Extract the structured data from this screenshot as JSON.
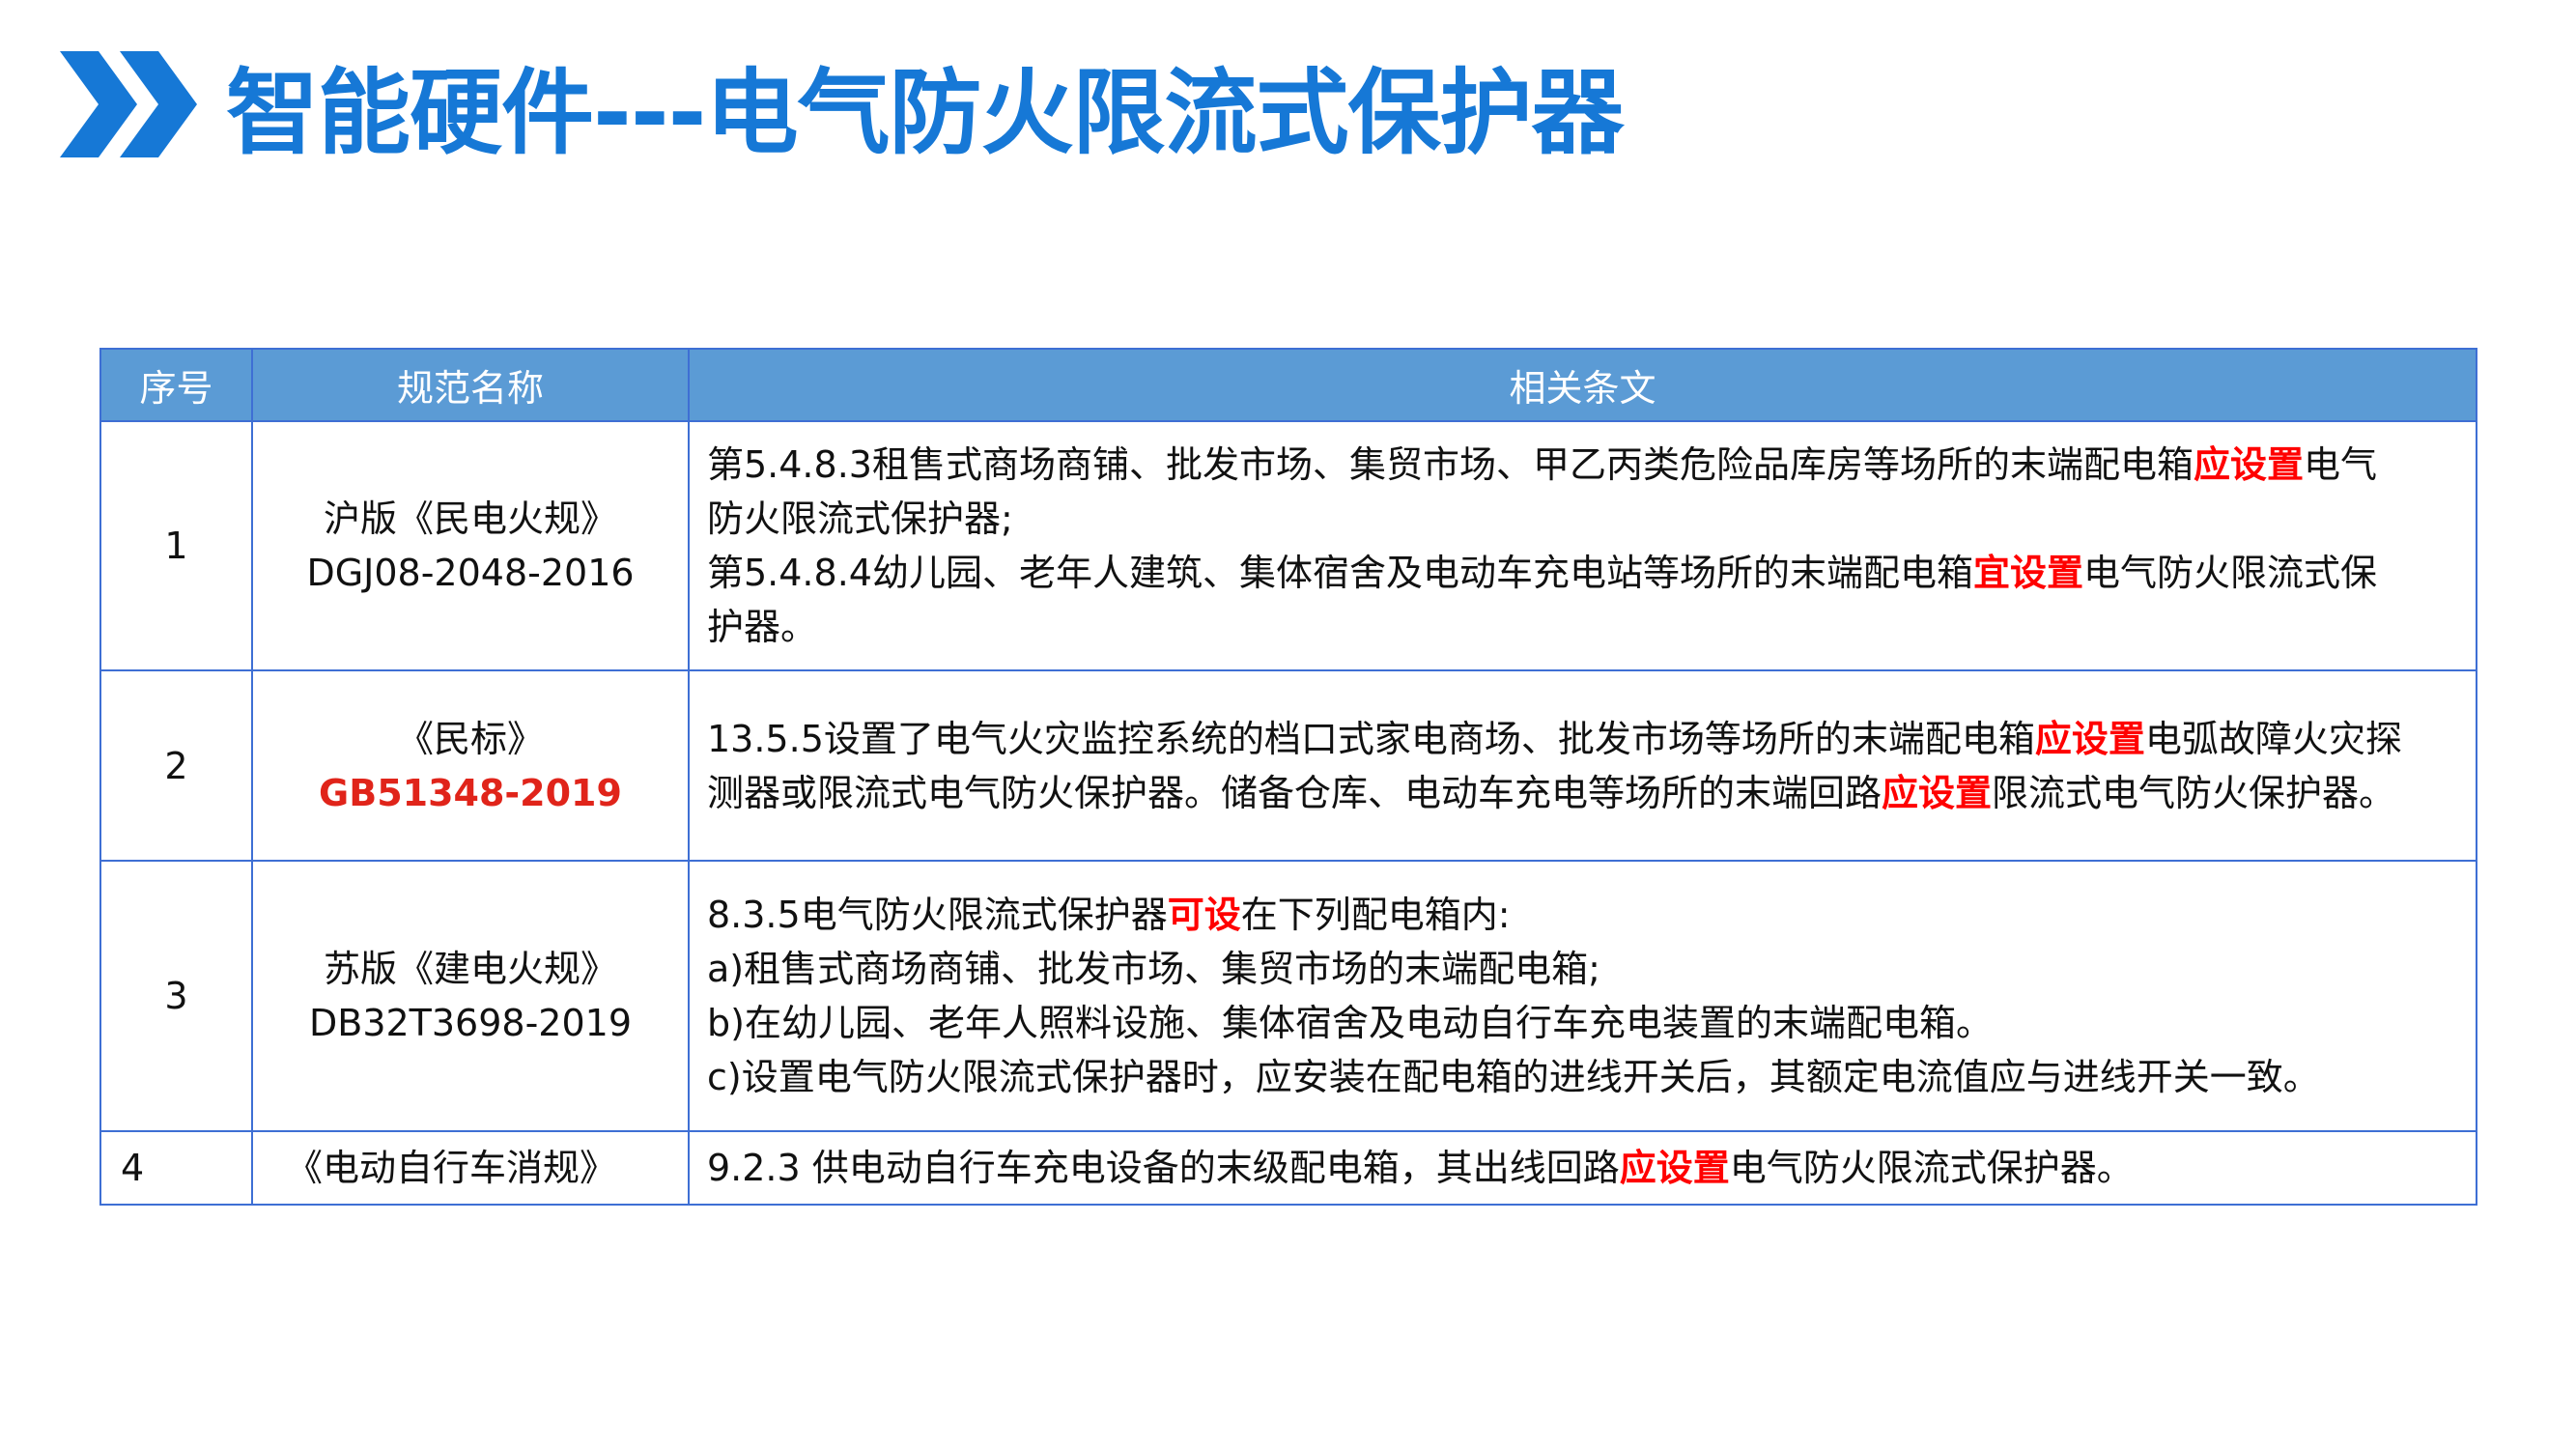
{
  "title": "智能硬件---电气防火限流式保护器",
  "icon": "double-chevron-right-icon",
  "accent_color": "#1678d6",
  "header_color": "#5b9bd5",
  "highlight_color": "#ff0000",
  "table": {
    "headers": {
      "no": "序号",
      "name": "规范名称",
      "text": "相关条文"
    },
    "rows": [
      {
        "no": "1",
        "name_line1": "沪版《民电火规》",
        "name_line2": "DGJ08-2048-2016",
        "text": [
          {
            "a": "第5.4.8.3租售式商场商铺、批发市场、集贸市场、甲乙丙类危险品库房等场所的末端配电箱",
            "hl": "应设置",
            "b": "电气"
          },
          {
            "a": "防火限流式保护器;",
            "hl": "",
            "b": ""
          },
          {
            "a": "第5.4.8.4幼儿园、老年人建筑、集体宿舍及电动车充电站等场所的末端配电箱",
            "hl": "宜设置",
            "b": "电气防火限流式保"
          },
          {
            "a": "护器。",
            "hl": "",
            "b": ""
          }
        ]
      },
      {
        "no": "2",
        "name_line1": "《民标》",
        "name_line2": "GB51348-2019",
        "text": [
          {
            "a": "13.5.5设置了电气火灾监控系统的档口式家电商场、批发市场等场所的末端配电箱",
            "hl": "应设置",
            "b": "电弧故障火灾探"
          },
          {
            "a": "测器或限流式电气防火保护器。储备仓库、电动车充电等场所的末端回路",
            "hl": "应设置",
            "b": "限流式电气防火保护器。"
          }
        ]
      },
      {
        "no": "3",
        "name_line1": "苏版《建电火规》",
        "name_line2": "DB32T3698-2019",
        "text": [
          {
            "a": "8.3.5电气防火限流式保护器",
            "hl": "可设",
            "b": "在下列配电箱内:"
          },
          {
            "a": "a)租售式商场商铺、批发市场、集贸市场的末端配电箱;",
            "hl": "",
            "b": ""
          },
          {
            "a": "b)在幼儿园、老年人照料设施、集体宿舍及电动自行车充电装置的末端配电箱。",
            "hl": "",
            "b": ""
          },
          {
            "a": "c)设置电气防火限流式保护器时，应安装在配电箱的进线开关后，其额定电流值应与进线开关一致。",
            "hl": "",
            "b": ""
          }
        ]
      },
      {
        "no": "4",
        "name_line1": "《电动自行车消规》",
        "text": [
          {
            "a": "9.2.3 供电动自行车充电设备的末级配电箱，其出线回路",
            "hl": "应设置",
            "b": "电气防火限流式保护器。"
          }
        ]
      }
    ]
  }
}
